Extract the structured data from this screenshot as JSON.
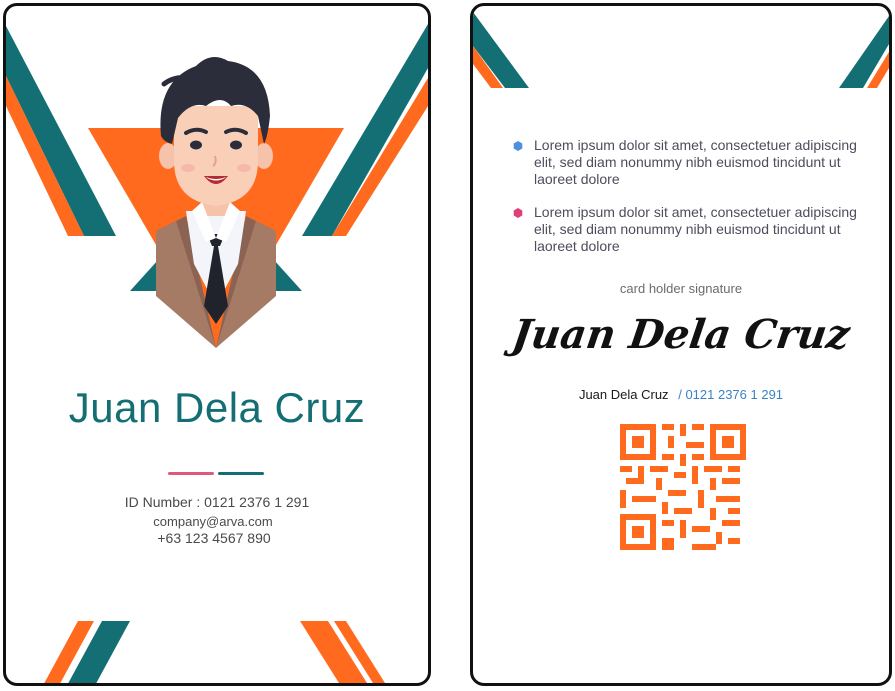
{
  "front": {
    "name": "Juan Dela Cruz",
    "id_label": "ID Number :",
    "id_number": "0121 2376 1 291",
    "email": "company@arva.com",
    "phone": "+63 123 4567 890"
  },
  "back": {
    "bullets": [
      {
        "icon": "blue-hexagon-icon",
        "color": "#4f8fe0",
        "text": "Lorem ipsum dolor sit amet, consectetuer adipiscing elit, sed diam nonummy nibh euismod tincidunt ut laoreet dolore"
      },
      {
        "icon": "pink-hexagon-icon",
        "color": "#e0407a",
        "text": "Lorem ipsum dolor sit amet, consectetuer adipiscing elit, sed diam nonummy nibh euismod tincidunt ut laoreet dolore"
      }
    ],
    "signature_label": "card holder signature",
    "signature": "Juan Dela Cruz",
    "holder_name": "Juan Dela Cruz",
    "holder_separator": "/",
    "holder_id": "0121 2376 1 291"
  },
  "colors": {
    "teal": "#146f75",
    "orange": "#ff6a1f",
    "pink": "#e0587a",
    "qr": "#ff6a1f"
  }
}
